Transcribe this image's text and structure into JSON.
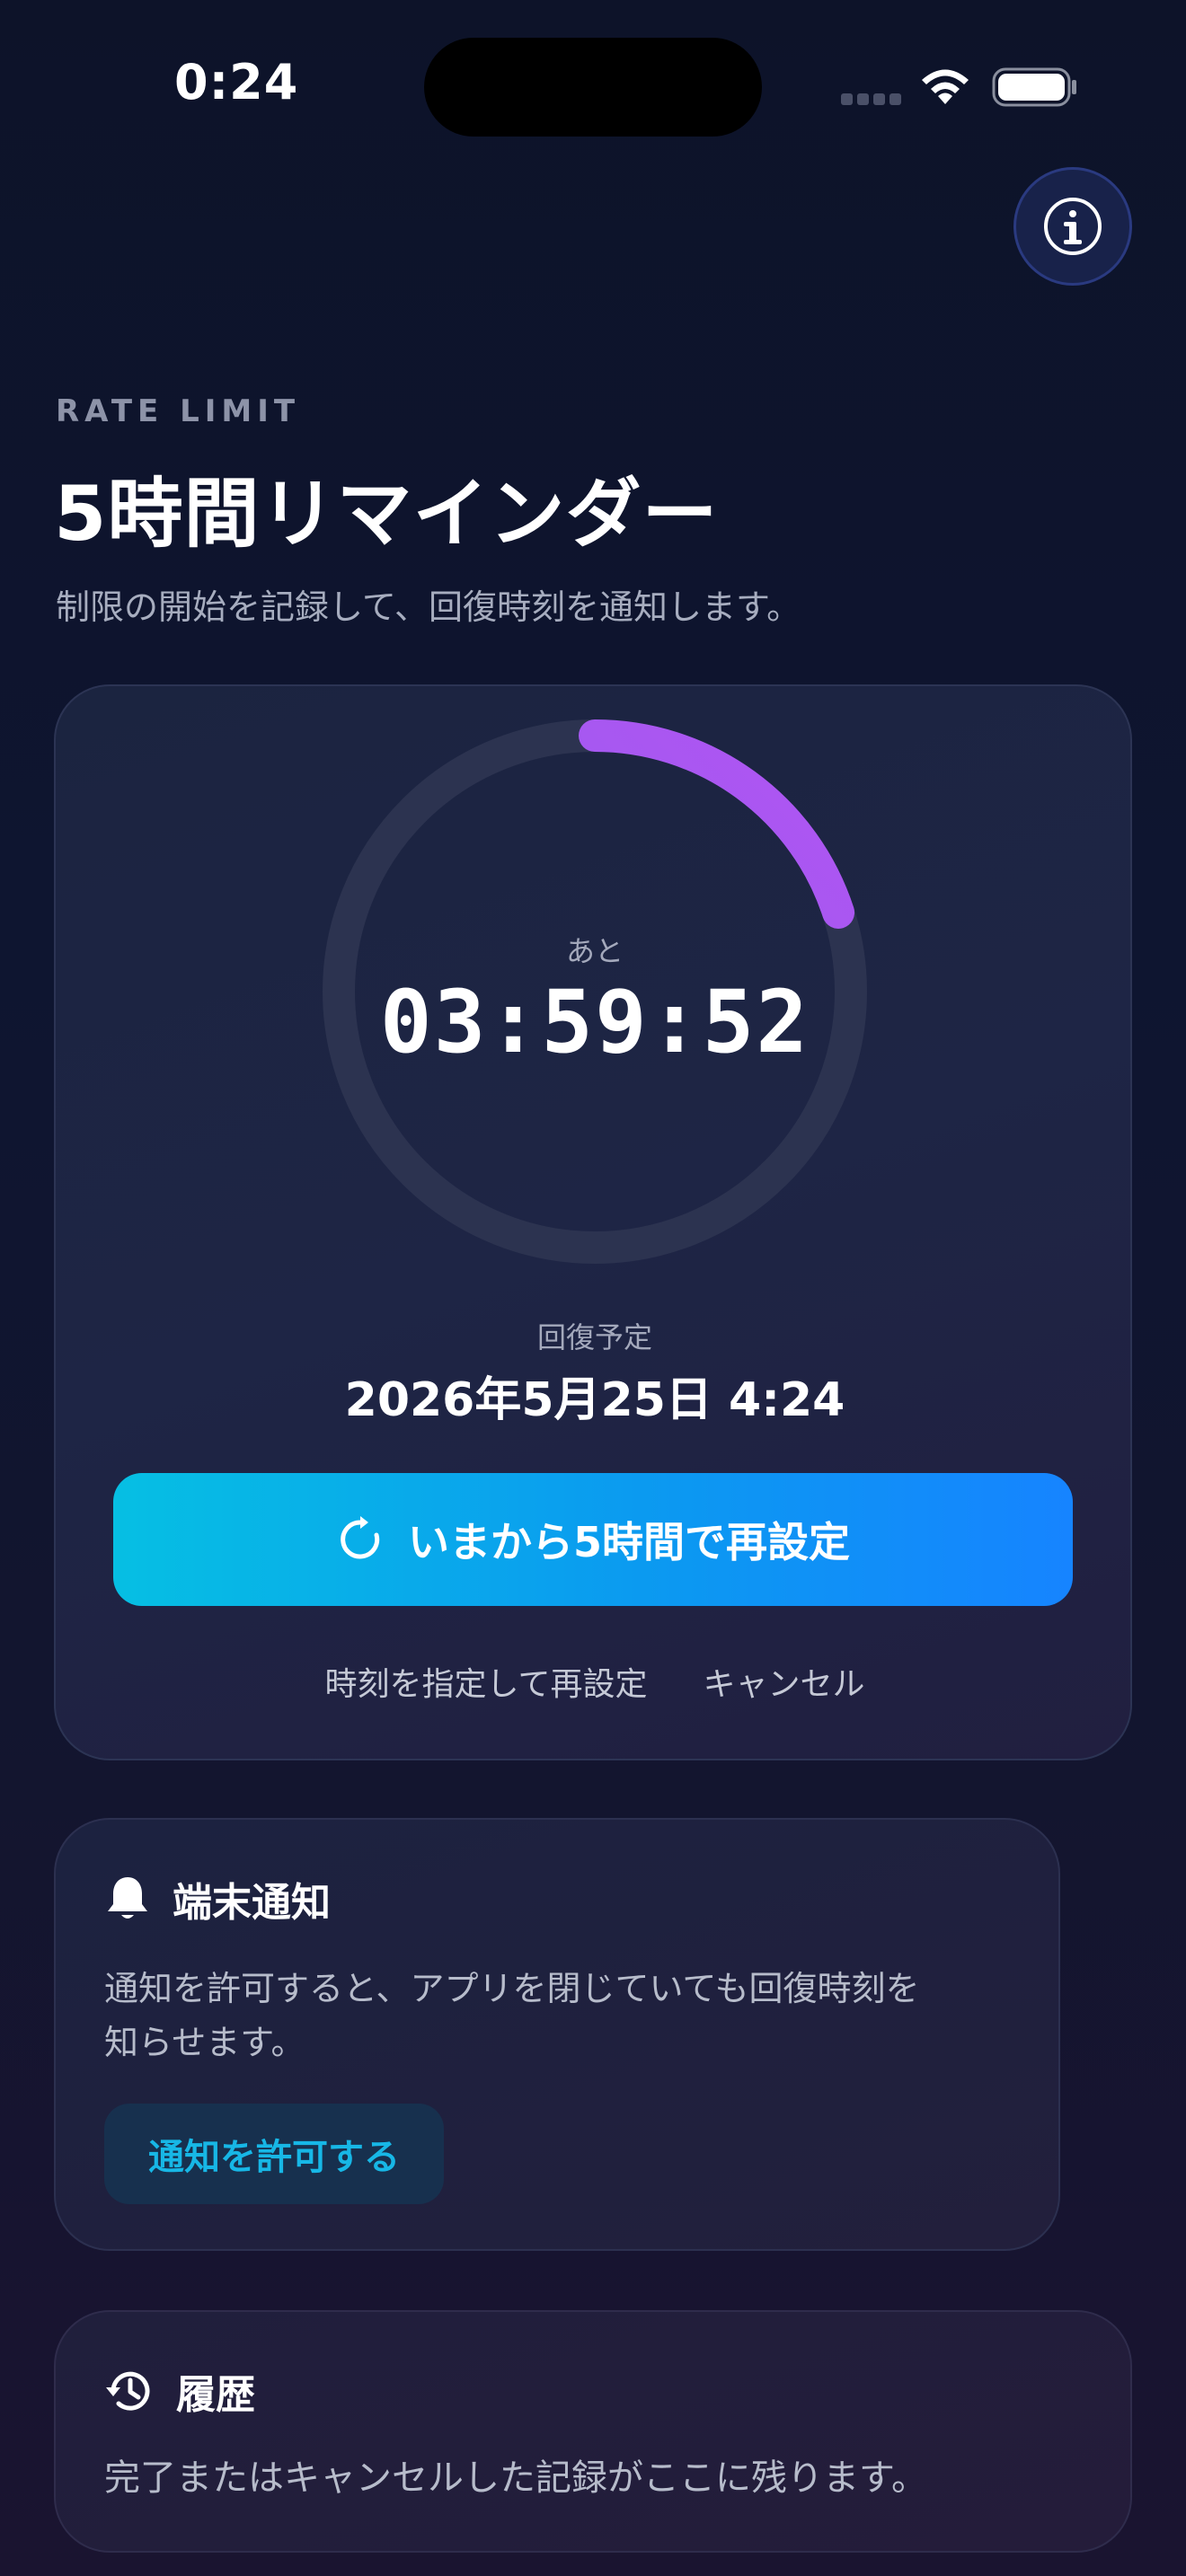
{
  "status_bar": {
    "time": "0:24",
    "icons": [
      "cellular-signal-icon",
      "wifi-icon",
      "battery-icon"
    ]
  },
  "header": {
    "eyebrow": "RATE LIMIT",
    "title": "5時間リマインダー",
    "subtitle": "制限の開始を記録して、回復時刻を通知します。",
    "info_icon": "info-icon"
  },
  "timer": {
    "remaining_label": "あと",
    "remaining_time": "03:59:52",
    "progress_fraction": 0.2,
    "recovery_label": "回復予定",
    "recovery_value": "2026年5月25日 4:24",
    "reset_button_label": "いまから5時間で再設定",
    "reset_icon": "refresh-icon",
    "secondary_actions": {
      "set_time": "時刻を指定して再設定",
      "cancel": "キャンセル"
    }
  },
  "notifications": {
    "icon": "bell-icon",
    "title": "端末通知",
    "description_line1": "通知を許可すると、アプリを閉じていても回復時刻を",
    "description_line2": "知らせます。",
    "allow_button": "通知を許可する"
  },
  "history": {
    "icon": "history-icon",
    "title": "履歴",
    "description": "完了またはキャンセルした記録がここに残ります。"
  },
  "colors": {
    "accent_purple": "#9b5cf0",
    "accent_cyan": "#06bfe3",
    "accent_blue": "#1684ff",
    "link_cyan": "#17b7e6"
  }
}
